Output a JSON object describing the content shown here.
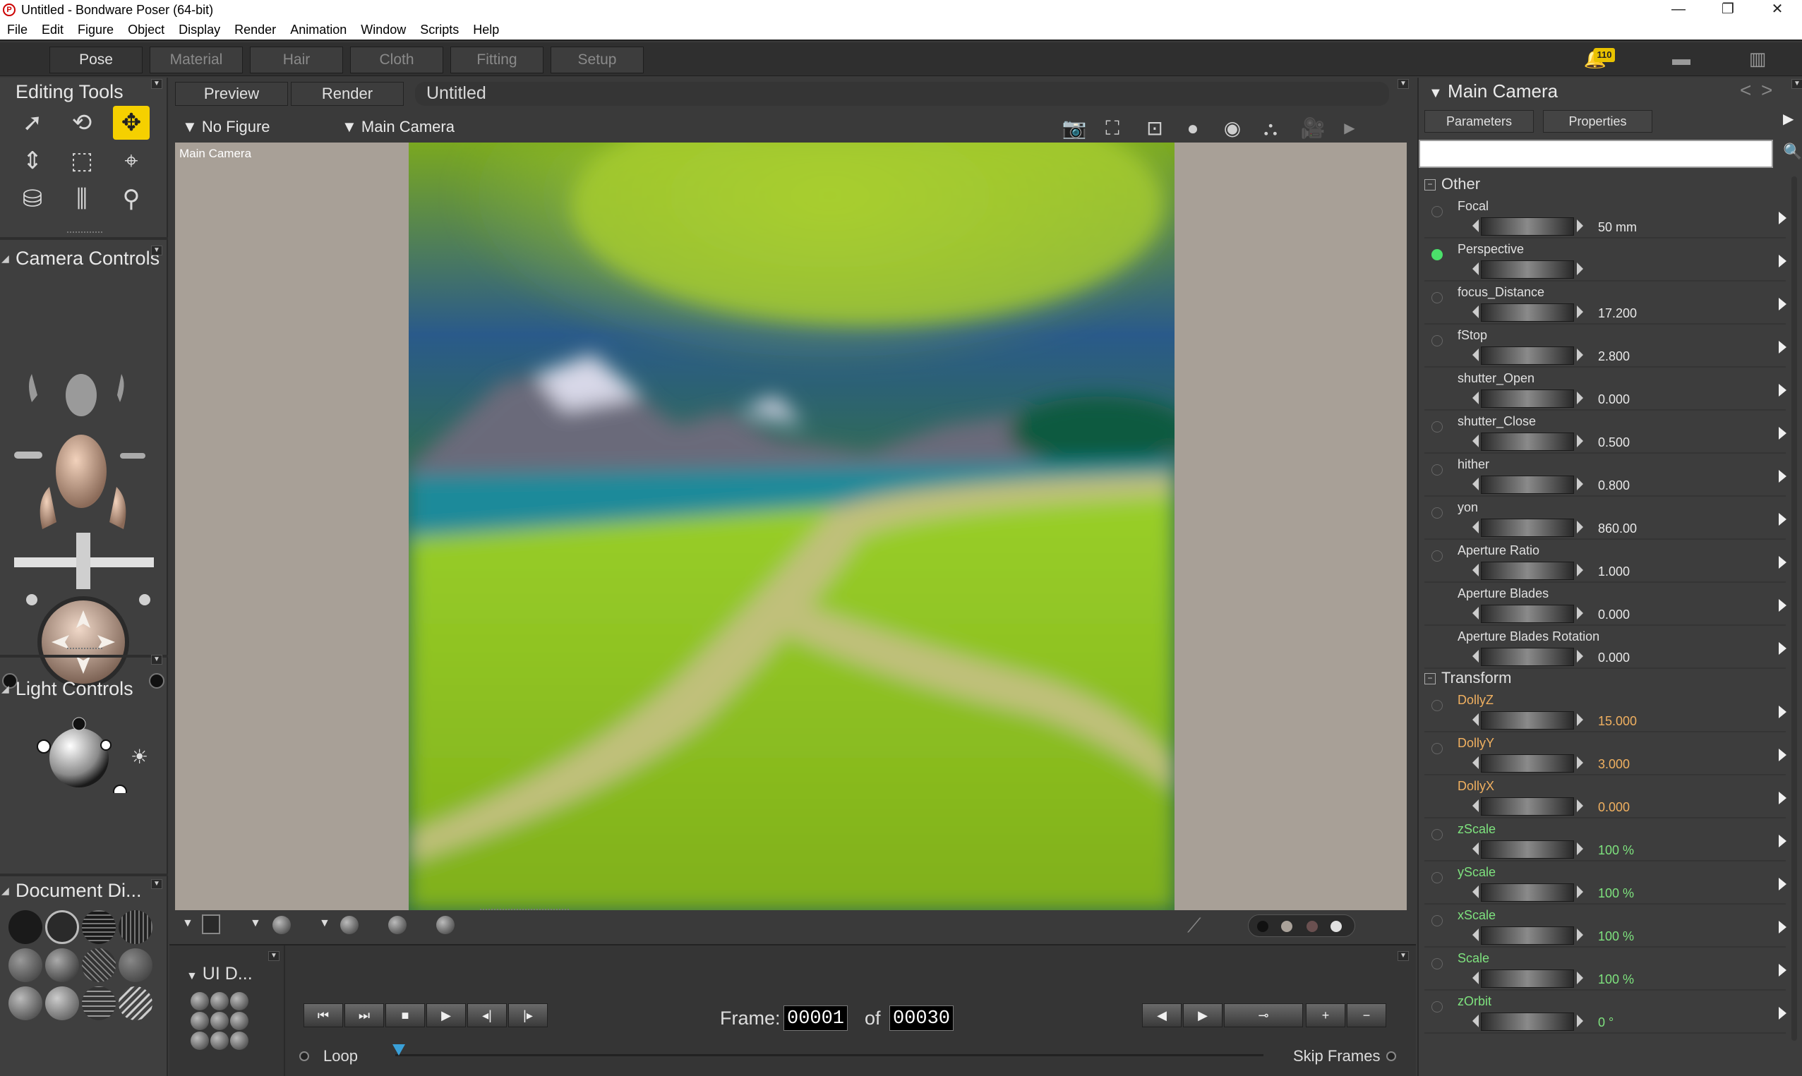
{
  "window": {
    "title": "Untitled - Bondware Poser (64-bit)",
    "app_icon_glyph": "P",
    "controls": [
      "—",
      "❐",
      "✕"
    ]
  },
  "menubar": [
    "File",
    "Edit",
    "Figure",
    "Object",
    "Display",
    "Render",
    "Animation",
    "Window",
    "Scripts",
    "Help"
  ],
  "rooms": [
    "Pose",
    "Material",
    "Hair",
    "Cloth",
    "Fitting",
    "Setup"
  ],
  "notifications": {
    "count": "110"
  },
  "left_panel": {
    "editing_tools_title": "Editing Tools",
    "camera_controls_title": "Camera Controls",
    "light_controls_title": "Light Controls",
    "document_display_title": "Document Di..."
  },
  "document": {
    "tabs": [
      "Preview",
      "Render"
    ],
    "title": "Untitled",
    "figure_select": "No Figure",
    "camera_select": "Main Camera",
    "viewport_label": "Main Camera"
  },
  "animation": {
    "ui_label": "UI D...",
    "frame_label": "Frame:",
    "current_frame": "00001",
    "of_label": "of",
    "total_frames": "00030",
    "loop_label": "Loop",
    "skip_frames_label": "Skip Frames",
    "buttons": [
      "⏮",
      "⏭",
      "■",
      "▶",
      "◂|",
      "|▸"
    ],
    "key_buttons": [
      "◀",
      "▶",
      "⊸",
      "+",
      "−"
    ]
  },
  "parameters": {
    "title": "Main Camera",
    "tabs": [
      "Parameters",
      "Properties"
    ],
    "search_value": "",
    "groups": [
      {
        "name": "Other",
        "items": [
          {
            "name": "Focal",
            "value": "50 mm",
            "color": "white",
            "radio": "off"
          },
          {
            "name": "Perspective",
            "value": "",
            "color": "white",
            "radio": "on"
          },
          {
            "name": "focus_Distance",
            "value": "17.200",
            "color": "white",
            "radio": "off"
          },
          {
            "name": "fStop",
            "value": "2.800",
            "color": "white",
            "radio": "off"
          },
          {
            "name": "shutter_Open",
            "value": "0.000",
            "color": "white",
            "radio": "none"
          },
          {
            "name": "shutter_Close",
            "value": "0.500",
            "color": "white",
            "radio": "off"
          },
          {
            "name": "hither",
            "value": "0.800",
            "color": "white",
            "radio": "off"
          },
          {
            "name": "yon",
            "value": "860.00",
            "color": "white",
            "radio": "off"
          },
          {
            "name": "Aperture Ratio",
            "value": "1.000",
            "color": "white",
            "radio": "off"
          },
          {
            "name": "Aperture Blades",
            "value": "0.000",
            "color": "white",
            "radio": "none"
          },
          {
            "name": "Aperture Blades Rotation",
            "value": "0.000",
            "color": "white",
            "radio": "none"
          }
        ]
      },
      {
        "name": "Transform",
        "items": [
          {
            "name": "DollyZ",
            "value": "15.000",
            "color": "orange",
            "radio": "off"
          },
          {
            "name": "DollyY",
            "value": "3.000",
            "color": "orange",
            "radio": "off"
          },
          {
            "name": "DollyX",
            "value": "0.000",
            "color": "orange",
            "radio": "none"
          },
          {
            "name": "zScale",
            "value": "100 %",
            "color": "green",
            "radio": "off"
          },
          {
            "name": "yScale",
            "value": "100 %",
            "color": "green",
            "radio": "off"
          },
          {
            "name": "xScale",
            "value": "100 %",
            "color": "green",
            "radio": "off"
          },
          {
            "name": "Scale",
            "value": "100 %",
            "color": "green",
            "radio": "off"
          },
          {
            "name": "zOrbit",
            "value": "0 °",
            "color": "green",
            "radio": "off"
          }
        ]
      }
    ]
  },
  "colors": {
    "accent_yellow": "#f5d000",
    "active_green": "#4be06a",
    "param_orange": "#f0b060",
    "param_green": "#7ee27e"
  }
}
